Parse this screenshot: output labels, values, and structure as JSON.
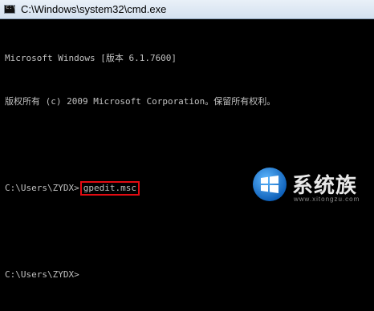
{
  "window": {
    "title": "C:\\Windows\\system32\\cmd.exe"
  },
  "console": {
    "line1": "Microsoft Windows [版本 6.1.7600]",
    "line2": "版权所有 (c) 2009 Microsoft Corporation。保留所有权利。",
    "prompt1": "C:\\Users\\ZYDX>",
    "command": "gpedit.msc",
    "prompt2": "C:\\Users\\ZYDX>"
  },
  "watermark": {
    "brand": "系统族",
    "url": "www.xitongzu.com"
  },
  "colors": {
    "console_bg": "#000000",
    "console_text": "#c0c0c0",
    "highlight_border": "#e30b12",
    "logo_blue": "#1e88e5"
  },
  "icons": {
    "title_icon": "cmd-icon",
    "logo_icon": "windows-logo-icon"
  }
}
